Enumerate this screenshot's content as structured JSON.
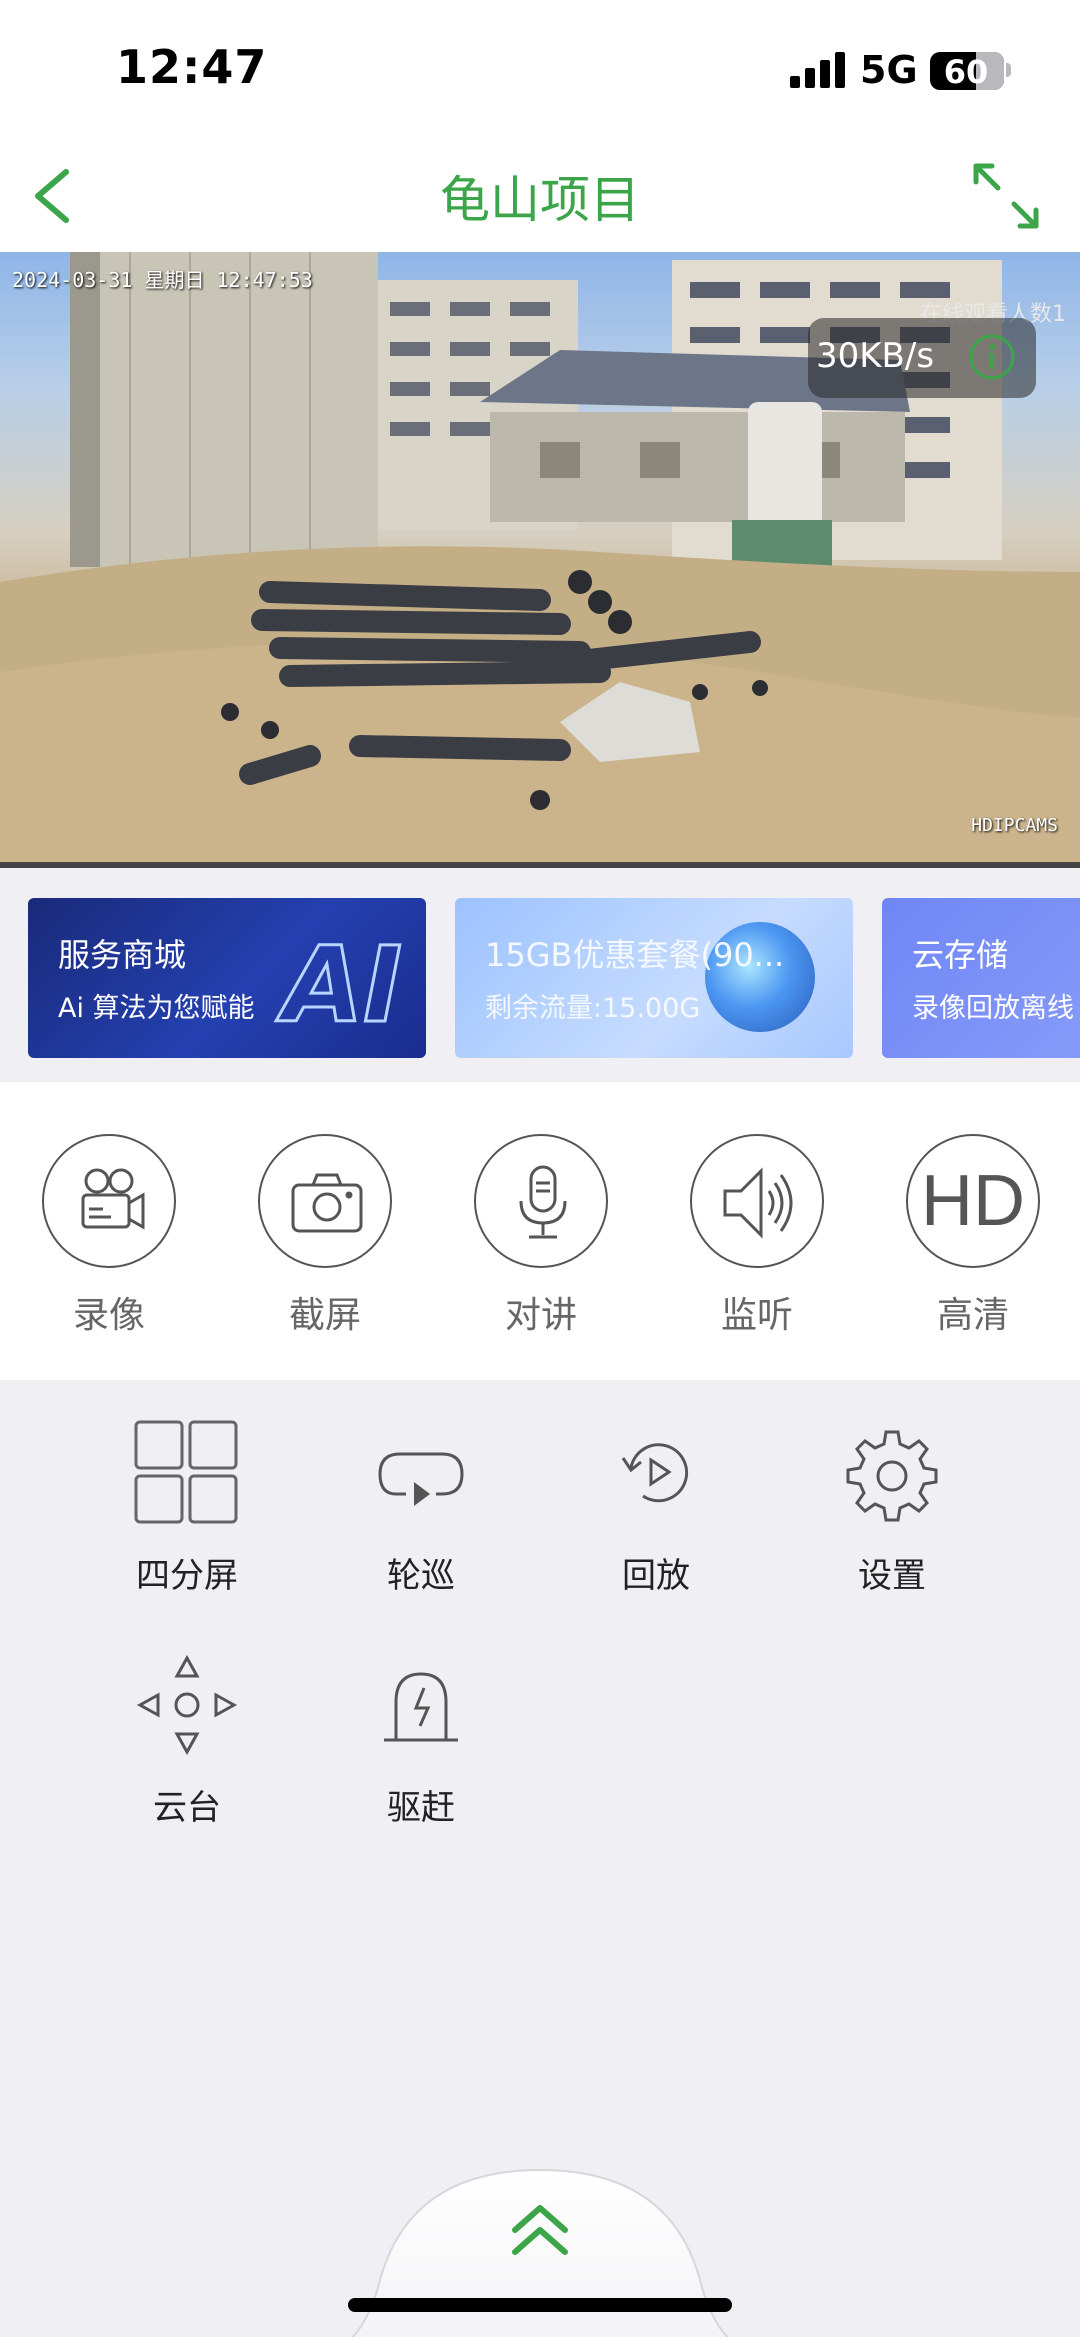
{
  "status_bar": {
    "time": "12:47",
    "network": "5G",
    "battery": "60"
  },
  "nav": {
    "title": "龟山项目",
    "accent_color": "#3ca54a"
  },
  "video": {
    "timestamp": "2024-03-31  星期日  12:47:53",
    "watermark": "HDIPCAMS",
    "viewers": "在线观看人数1",
    "speed": "30KB/s"
  },
  "banners": [
    {
      "title": "服务商城",
      "subtitle": "Ai 算法为您赋能",
      "badge": "AI"
    },
    {
      "title": "15GB优惠套餐(90...",
      "subtitle": "剩余流量:15.00G"
    },
    {
      "title": "云存储",
      "subtitle": "录像回放离线"
    }
  ],
  "controls": [
    {
      "label": "录像",
      "icon": "video-camera-icon"
    },
    {
      "label": "截屏",
      "icon": "camera-icon"
    },
    {
      "label": "对讲",
      "icon": "microphone-icon"
    },
    {
      "label": "监听",
      "icon": "speaker-icon"
    },
    {
      "label": "高清",
      "icon": "hd-icon",
      "badge": "HD"
    }
  ],
  "functions": [
    {
      "label": "四分屏",
      "icon": "grid-icon"
    },
    {
      "label": "轮巡",
      "icon": "loop-icon"
    },
    {
      "label": "回放",
      "icon": "replay-icon"
    },
    {
      "label": "设置",
      "icon": "gear-icon"
    },
    {
      "label": "云台",
      "icon": "ptz-icon"
    },
    {
      "label": "驱赶",
      "icon": "alarm-icon"
    }
  ]
}
